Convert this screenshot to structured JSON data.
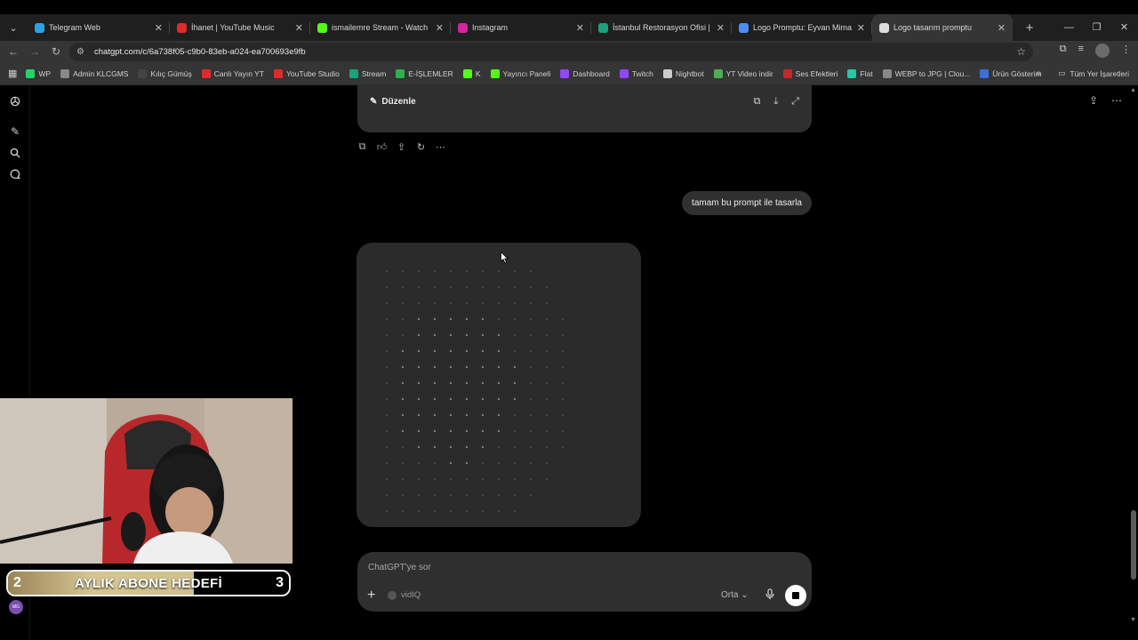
{
  "browser": {
    "tabs": [
      {
        "title": "Telegram Web",
        "icon": "telegram-icon",
        "color": "#2aa3e0",
        "active": false
      },
      {
        "title": "İhanet | YouTube Music",
        "icon": "youtube-music-icon",
        "color": "#e02b2b",
        "active": false
      },
      {
        "title": "ismailemre Stream - Watch Live",
        "icon": "kick-icon",
        "color": "#53fc18",
        "active": false
      },
      {
        "title": "Instagram",
        "icon": "instagram-icon",
        "color": "#d6249f",
        "active": false
      },
      {
        "title": "İstanbul Restorasyon Ofisi | Rö",
        "icon": "site-icon",
        "color": "#1aa37a",
        "active": false
      },
      {
        "title": "Logo Promptu: Eyvan Mimarlık",
        "icon": "gemini-icon",
        "color": "#4b8df8",
        "active": false
      },
      {
        "title": "Logo tasarım promptu",
        "icon": "chatgpt-icon",
        "color": "#dddddd",
        "active": true
      }
    ],
    "url": "chatgpt.com/c/6a738f05-c9b0-83eb-a024-ea700693e9fb",
    "bookmarks": [
      {
        "label": "WP",
        "color": "#25d366"
      },
      {
        "label": "Admin KLCGMS",
        "color": "#888888"
      },
      {
        "label": "Kılıç Gümüş",
        "color": "#444444"
      },
      {
        "label": "Canlı Yayın YT",
        "color": "#e02b2b"
      },
      {
        "label": "YouTube Studio",
        "color": "#e02b2b"
      },
      {
        "label": "Stream",
        "color": "#1aa37a"
      },
      {
        "label": "E-İŞLEMLER",
        "color": "#2bb24c"
      },
      {
        "label": "K",
        "color": "#53fc18"
      },
      {
        "label": "Yayıncı Paneli",
        "color": "#53fc18"
      },
      {
        "label": "Dashboard",
        "color": "#9146ff"
      },
      {
        "label": "Twitch",
        "color": "#9146ff"
      },
      {
        "label": "Nightbot",
        "color": "#cccccc"
      },
      {
        "label": "YT Video indir",
        "color": "#4caf50"
      },
      {
        "label": "Ses Efektleri",
        "color": "#c62828"
      },
      {
        "label": "Flat",
        "color": "#26c6a6"
      },
      {
        "label": "WEBP to JPG | Clou...",
        "color": "#888888"
      },
      {
        "label": "Ürün Gösterim",
        "color": "#3b6fd8"
      }
    ],
    "all_bookmarks": "Tüm Yer İşaretleri"
  },
  "chat": {
    "canvas_edit_label": "Düzenle",
    "user_message": "tamam bu prompt ile tasarla",
    "composer_placeholder": "ChatGPT'ye sor",
    "extension_label": "vidIQ",
    "effort_label": "Orta"
  },
  "overlay": {
    "goal_label": "AYLIK ABONE HEDEFİ",
    "goal_start": "2",
    "goal_target": "3",
    "goal_progress": 0.66,
    "avatar_initials": "MG"
  },
  "colors": {
    "page_bg": "#000000",
    "card_bg": "#2f2f2f",
    "goal_fill": "#d5c593"
  }
}
